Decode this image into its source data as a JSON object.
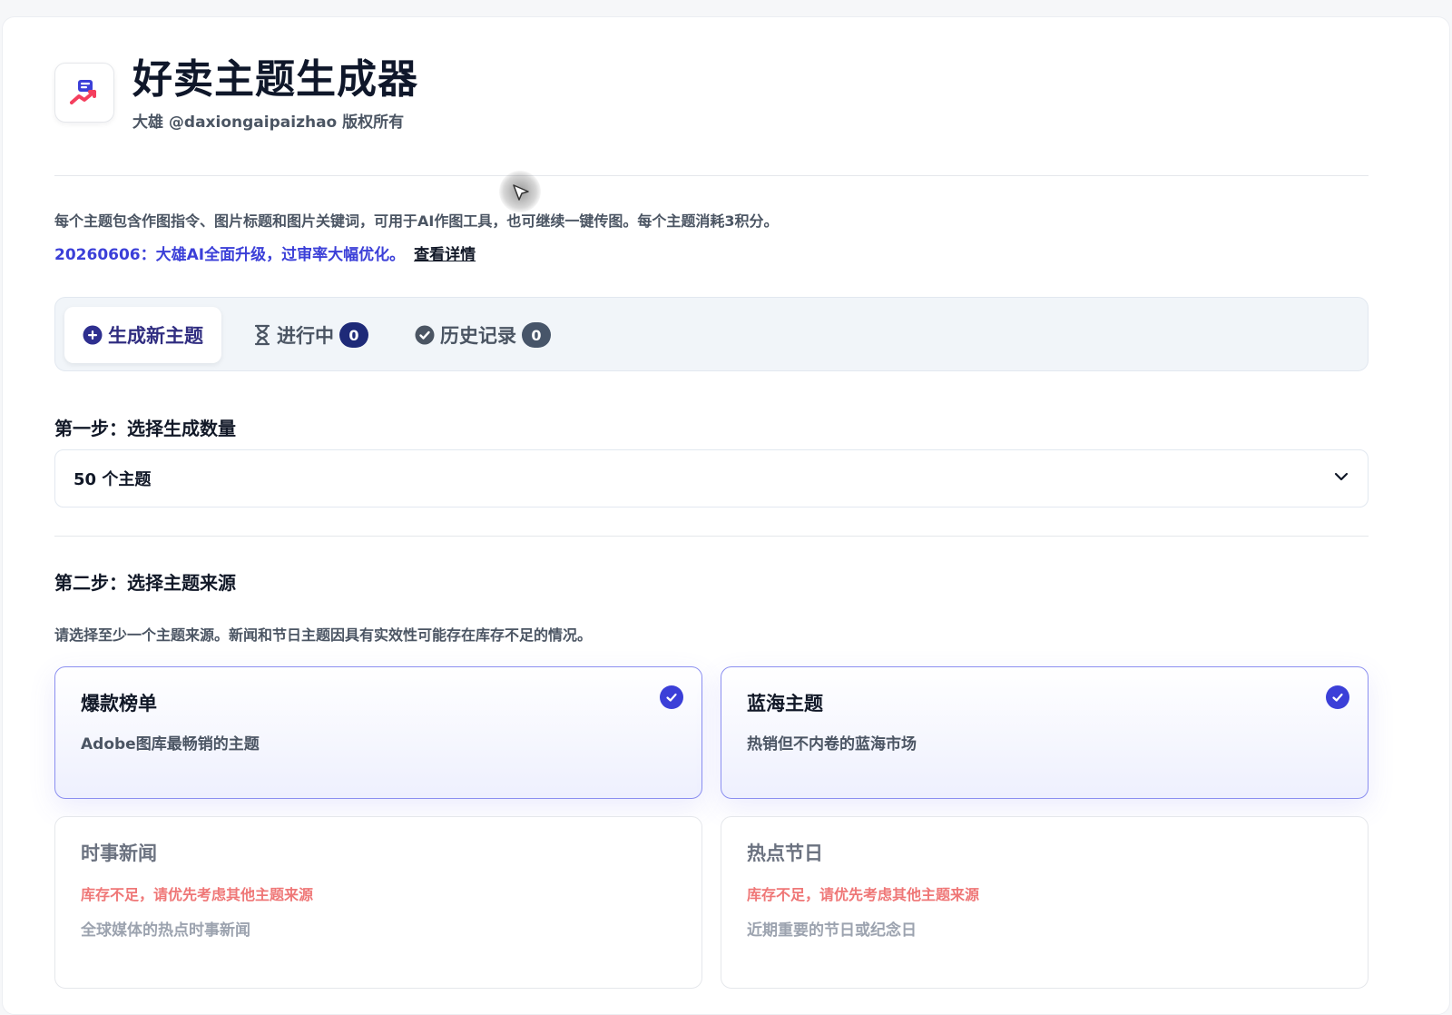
{
  "app": {
    "title": "好卖主题生成器",
    "subtitle": "大雄 @daxiongaipaizhao 版权所有"
  },
  "intro": {
    "description": "每个主题包含作图指令、图片标题和图片关键词，可用于AI作图工具，也可继续一键传图。每个主题消耗3积分。",
    "notice": "20260606：大雄AI全面升级，过审率大幅优化。",
    "notice_link": "查看详情"
  },
  "tabs": [
    {
      "label": "生成新主题",
      "icon": "plus-circle-icon",
      "active": true
    },
    {
      "label": "进行中",
      "icon": "hourglass-icon",
      "count": "0"
    },
    {
      "label": "历史记录",
      "icon": "check-circle-icon",
      "count": "0"
    }
  ],
  "step1": {
    "label": "第一步：选择生成数量",
    "selected_value": "50 个主题"
  },
  "step2": {
    "label": "第二步：选择主题来源",
    "hint": "请选择至少一个主题来源。新闻和节日主题因具有实效性可能存在库存不足的情况。",
    "sources": [
      {
        "title": "爆款榜单",
        "description": "Adobe图库最畅销的主题",
        "selected": true
      },
      {
        "title": "蓝海主题",
        "description": "热销但不内卷的蓝海市场",
        "selected": true
      },
      {
        "title": "时事新闻",
        "warning": "库存不足，请优先考虑其他主题来源",
        "description": "全球媒体的热点时事新闻",
        "selected": false
      },
      {
        "title": "热点节日",
        "warning": "库存不足，请优先考虑其他主题来源",
        "description": "近期重要的节日或纪念日",
        "selected": false
      }
    ]
  },
  "colors": {
    "accent": "#3b3fd8",
    "active_tab_text": "#312e81",
    "badge_progress": "#1e2a78",
    "badge_history": "#475569",
    "warning": "#ef7777"
  }
}
